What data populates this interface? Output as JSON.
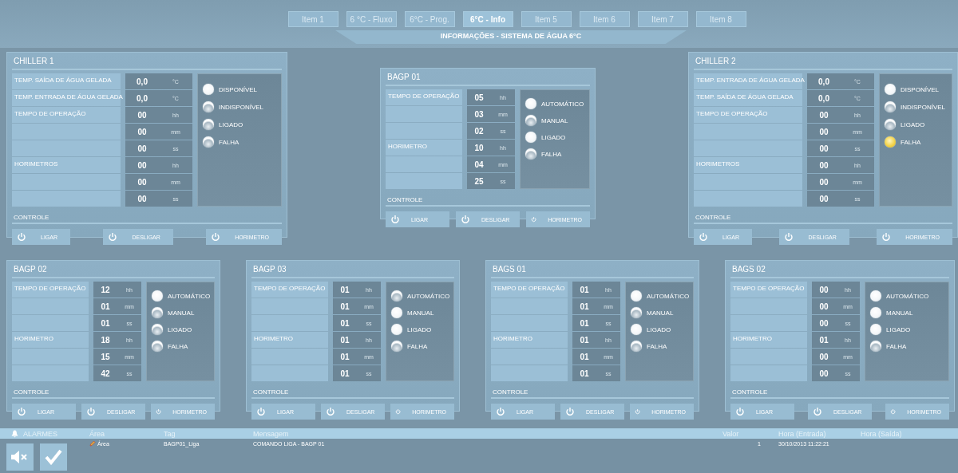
{
  "nav": {
    "tabs": [
      {
        "label": "Item 1",
        "selected": false
      },
      {
        "label": "6 °C - Fluxo",
        "selected": false
      },
      {
        "label": "6°C - Prog.",
        "selected": false
      },
      {
        "label": "6°C - Info",
        "selected": true
      },
      {
        "label": "Item 5",
        "selected": false
      },
      {
        "label": "Item 6",
        "selected": false
      },
      {
        "label": "Item 7",
        "selected": false
      },
      {
        "label": "Item 8",
        "selected": false
      }
    ],
    "title": "INFORMAÇÕES - SISTEMA DE ÁGUA 6°C"
  },
  "top_panels": [
    {
      "kind": "chiller",
      "title": "CHILLER 1",
      "rows": [
        {
          "label": "TEMP. SAÍDA DE ÁGUA GELADA",
          "value": "0,0",
          "unit": "°C"
        },
        {
          "label": "TEMP. ENTRADA DE ÁGUA GELADA",
          "value": "0,0",
          "unit": "°C"
        },
        {
          "label": "TEMPO DE OPERAÇÃO",
          "value": "00",
          "unit": "hh"
        },
        {
          "value": "00",
          "unit": "mm"
        },
        {
          "value": "00",
          "unit": "ss"
        },
        {
          "label": "HORIMETROS",
          "value": "00",
          "unit": "hh"
        },
        {
          "value": "00",
          "unit": "mm"
        },
        {
          "value": "00",
          "unit": "ss"
        }
      ],
      "lamps": [
        {
          "label": "DISPONÍVEL",
          "on": true,
          "alarm": false
        },
        {
          "label": "INDISPONÍVEL",
          "on": false,
          "alarm": false
        },
        {
          "label": "LIGADO",
          "on": false,
          "alarm": false
        },
        {
          "label": "FALHA",
          "on": false,
          "alarm": false
        }
      ],
      "control_label": "CONTROLE",
      "buttons": [
        "LIGAR",
        "DESLIGAR",
        "HORIMETRO"
      ]
    },
    {
      "kind": "pump",
      "title": "BAGP 01",
      "rows": [
        {
          "label": "TEMPO DE OPERAÇÃO",
          "value": "05",
          "unit": "hh"
        },
        {
          "value": "03",
          "unit": "mm"
        },
        {
          "value": "02",
          "unit": "ss"
        },
        {
          "label": "HORIMETRO",
          "value": "10",
          "unit": "hh"
        },
        {
          "value": "04",
          "unit": "mm"
        },
        {
          "value": "25",
          "unit": "ss"
        }
      ],
      "lamps": [
        {
          "label": "AUTOMÁTICO",
          "on": true,
          "alarm": false
        },
        {
          "label": "MANUAL",
          "on": false,
          "alarm": false
        },
        {
          "label": "LIGADO",
          "on": true,
          "alarm": false
        },
        {
          "label": "FALHA",
          "on": false,
          "alarm": false
        }
      ],
      "control_label": "CONTROLE",
      "buttons": [
        "LIGAR",
        "DESLIGAR",
        "HORIMETRO"
      ]
    },
    {
      "kind": "chiller",
      "title": "CHILLER 2",
      "rows": [
        {
          "label": "TEMP. ENTRADA DE ÁGUA GELADA",
          "value": "0,0",
          "unit": "°C"
        },
        {
          "label": "TEMP. SAÍDA DE ÁGUA GELADA",
          "value": "0,0",
          "unit": "°C"
        },
        {
          "label": "TEMPO DE OPERAÇÃO",
          "value": "00",
          "unit": "hh"
        },
        {
          "value": "00",
          "unit": "mm"
        },
        {
          "value": "00",
          "unit": "ss"
        },
        {
          "label": "HORIMETROS",
          "value": "00",
          "unit": "hh"
        },
        {
          "value": "00",
          "unit": "mm"
        },
        {
          "value": "00",
          "unit": "ss"
        }
      ],
      "lamps": [
        {
          "label": "DISPONÍVEL",
          "on": true,
          "alarm": false
        },
        {
          "label": "INDISPONÍVEL",
          "on": false,
          "alarm": false
        },
        {
          "label": "LIGADO",
          "on": false,
          "alarm": false
        },
        {
          "label": "FALHA",
          "on": true,
          "alarm": true
        }
      ],
      "control_label": "CONTROLE",
      "buttons": [
        "LIGAR",
        "DESLIGAR",
        "HORIMETRO"
      ]
    }
  ],
  "bottom_panels": [
    {
      "kind": "pump",
      "title": "BAGP 02",
      "rows": [
        {
          "label": "TEMPO DE OPERAÇÃO",
          "value": "12",
          "unit": "hh"
        },
        {
          "value": "01",
          "unit": "mm"
        },
        {
          "value": "01",
          "unit": "ss"
        },
        {
          "label": "HORIMETRO",
          "value": "18",
          "unit": "hh"
        },
        {
          "value": "15",
          "unit": "mm"
        },
        {
          "value": "42",
          "unit": "ss"
        }
      ],
      "lamps": [
        {
          "label": "AUTOMÁTICO",
          "on": true,
          "alarm": false
        },
        {
          "label": "MANUAL",
          "on": false,
          "alarm": false
        },
        {
          "label": "LIGADO",
          "on": false,
          "alarm": false
        },
        {
          "label": "FALHA",
          "on": false,
          "alarm": false
        }
      ],
      "control_label": "CONTROLE",
      "buttons": [
        "LIGAR",
        "DESLIGAR",
        "HORIMETRO"
      ]
    },
    {
      "kind": "pump",
      "title": "BAGP 03",
      "rows": [
        {
          "label": "TEMPO DE OPERAÇÃO",
          "value": "01",
          "unit": "hh"
        },
        {
          "value": "01",
          "unit": "mm"
        },
        {
          "value": "01",
          "unit": "ss"
        },
        {
          "label": "HORIMETRO",
          "value": "01",
          "unit": "hh"
        },
        {
          "value": "01",
          "unit": "mm"
        },
        {
          "value": "01",
          "unit": "ss"
        }
      ],
      "lamps": [
        {
          "label": "AUTOMÁTICO",
          "on": false,
          "alarm": false
        },
        {
          "label": "MANUAL",
          "on": true,
          "alarm": false
        },
        {
          "label": "LIGADO",
          "on": true,
          "alarm": false
        },
        {
          "label": "FALHA",
          "on": false,
          "alarm": false
        }
      ],
      "control_label": "CONTROLE",
      "buttons": [
        "LIGAR",
        "DESLIGAR",
        "HORIMETRO"
      ]
    },
    {
      "kind": "pump",
      "title": "BAGS 01",
      "rows": [
        {
          "label": "TEMPO DE OPERAÇÃO",
          "value": "01",
          "unit": "hh"
        },
        {
          "value": "01",
          "unit": "mm"
        },
        {
          "value": "01",
          "unit": "ss"
        },
        {
          "label": "HORIMETRO",
          "value": "01",
          "unit": "hh"
        },
        {
          "value": "01",
          "unit": "mm"
        },
        {
          "value": "01",
          "unit": "ss"
        }
      ],
      "lamps": [
        {
          "label": "AUTOMÁTICO",
          "on": true,
          "alarm": false
        },
        {
          "label": "MANUAL",
          "on": false,
          "alarm": false
        },
        {
          "label": "LIGADO",
          "on": true,
          "alarm": false
        },
        {
          "label": "FALHA",
          "on": false,
          "alarm": false
        }
      ],
      "control_label": "CONTROLE",
      "buttons": [
        "LIGAR",
        "DESLIGAR",
        "HORIMETRO"
      ]
    },
    {
      "kind": "pump",
      "title": "BAGS 02",
      "rows": [
        {
          "label": "TEMPO DE OPERAÇÃO",
          "value": "00",
          "unit": "hh"
        },
        {
          "value": "00",
          "unit": "mm"
        },
        {
          "value": "00",
          "unit": "ss"
        },
        {
          "label": "HORIMETRO",
          "value": "01",
          "unit": "hh"
        },
        {
          "value": "00",
          "unit": "mm"
        },
        {
          "value": "00",
          "unit": "ss"
        }
      ],
      "lamps": [
        {
          "label": "AUTOMÁTICO",
          "on": true,
          "alarm": false
        },
        {
          "label": "MANUAL",
          "on": true,
          "alarm": false
        },
        {
          "label": "LIGADO",
          "on": true,
          "alarm": false
        },
        {
          "label": "FALHA",
          "on": false,
          "alarm": false
        }
      ],
      "control_label": "CONTROLE",
      "buttons": [
        "LIGAR",
        "DESLIGAR",
        "HORIMETRO"
      ]
    }
  ],
  "alarms": {
    "title": "ALARMES",
    "columns": [
      "Área",
      "Tag",
      "Mensagem",
      "Valor",
      "Hora (Entrada)",
      "Hora (Saída)"
    ],
    "rows": [
      {
        "area": "Área",
        "tag": "BAGP01_Liga",
        "message": "COMANDO LIGA - BAGP 01",
        "value": "1",
        "time_in": "30/10/2013 11:22:21"
      }
    ]
  }
}
